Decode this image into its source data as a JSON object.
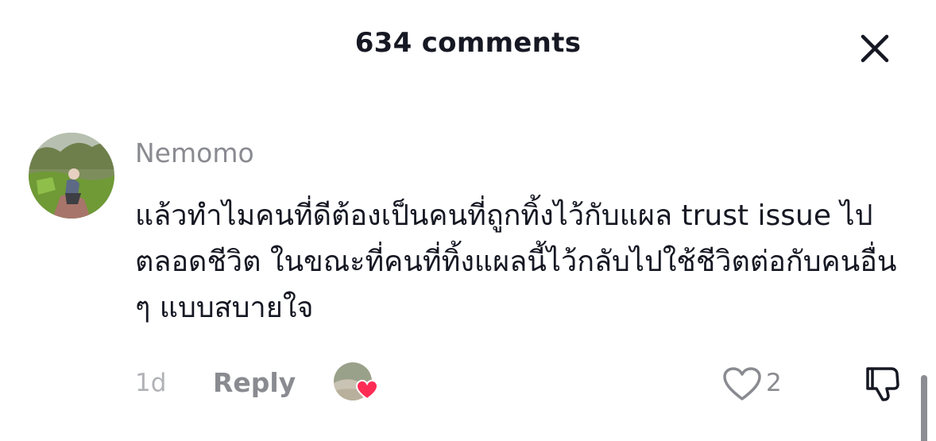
{
  "header": {
    "title": "634 comments",
    "close_icon": "close-icon"
  },
  "comment": {
    "username": "Nemomo",
    "text": "แล้วทำไมคนที่ดีต้องเป็นคนที่ถูกทิ้งไว้กับแผล trust issue ไปตลอดชีวิต ในขณะที่คนที่ทิ้งแผลนี้ไว้กลับไปใช้ชีวิตต่อกับคนอื่น ๆ แบบสบายใจ",
    "time": "1d",
    "reply_label": "Reply",
    "like_count": "2",
    "liked_by_creator": true
  },
  "colors": {
    "primary_text": "#161823",
    "secondary_text": "#8a8b91",
    "tertiary_text": "#b1b2b6",
    "heart_badge": "#fe2c55"
  },
  "icons": [
    "close-icon",
    "heart-outline-icon",
    "thumbs-down-icon",
    "heart-badge-icon"
  ]
}
